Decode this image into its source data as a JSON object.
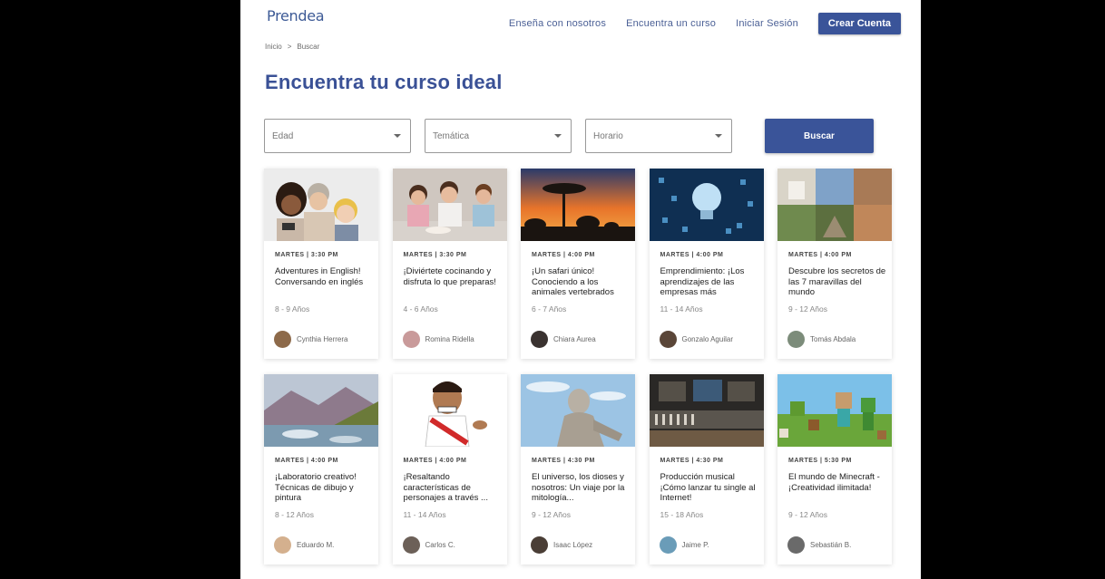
{
  "header": {
    "logo": "Prendea",
    "nav": [
      "Enseña con nosotros",
      "Encuentra un curso",
      "Iniciar Sesión"
    ],
    "cta": "Crear Cuenta"
  },
  "breadcrumb": [
    "Inicio",
    ">",
    "Buscar"
  ],
  "page_title": "Encuentra tu curso ideal",
  "filters": {
    "age": "Edad",
    "topic": "Temática",
    "schedule": "Horario",
    "search_button": "Buscar"
  },
  "courses": [
    {
      "meta": "MARTES | 3:30 PM",
      "title": "Adventures in English! Conversando en inglés",
      "age": "8 - 9 Años",
      "teacher": "Cynthia Herrera"
    },
    {
      "meta": "MARTES | 3:30 PM",
      "title": "¡Diviértete cocinando y disfruta lo que preparas!",
      "age": "4 - 6 Años",
      "teacher": "Romina Ridella"
    },
    {
      "meta": "MARTES | 4:00 PM",
      "title": "¡Un safari único! Conociendo a los animales vertebrados",
      "age": "6 - 7 Años",
      "teacher": "Chiara Aurea"
    },
    {
      "meta": "MARTES | 4:00 PM",
      "title": "Emprendimiento: ¡Los aprendizajes de las empresas más",
      "age": "11 - 14 Años",
      "teacher": "Gonzalo Aguilar"
    },
    {
      "meta": "MARTES | 4:00 PM",
      "title": "Descubre los secretos de las 7 maravillas del mundo",
      "age": "9 - 12 Años",
      "teacher": "Tomás Abdala"
    },
    {
      "meta": "MARTES | 4:00 PM",
      "title": "¡Laboratorio creativo! Técnicas de dibujo y pintura",
      "age": "8 - 12 Años",
      "teacher": "Eduardo M."
    },
    {
      "meta": "MARTES | 4:00 PM",
      "title": "¡Resaltando características de personajes a través ...",
      "age": "11 - 14 Años",
      "teacher": "Carlos C."
    },
    {
      "meta": "MARTES | 4:30 PM",
      "title": "El universo, los dioses y nosotros: Un viaje por la mitología...",
      "age": "9 - 12 Años",
      "teacher": "Isaac López"
    },
    {
      "meta": "MARTES | 4:30 PM",
      "title": "Producción musical ¡Cómo lanzar tu single al Internet!",
      "age": "15 - 18 Años",
      "teacher": "Jaime P."
    },
    {
      "meta": "MARTES | 5:30 PM",
      "title": "El mundo de Minecraft - ¡Creatividad ilimitada!",
      "age": "9 - 12 Años",
      "teacher": "Sebastián B."
    }
  ],
  "colors": {
    "brand": "#3a5499",
    "title": "#3a5196"
  }
}
